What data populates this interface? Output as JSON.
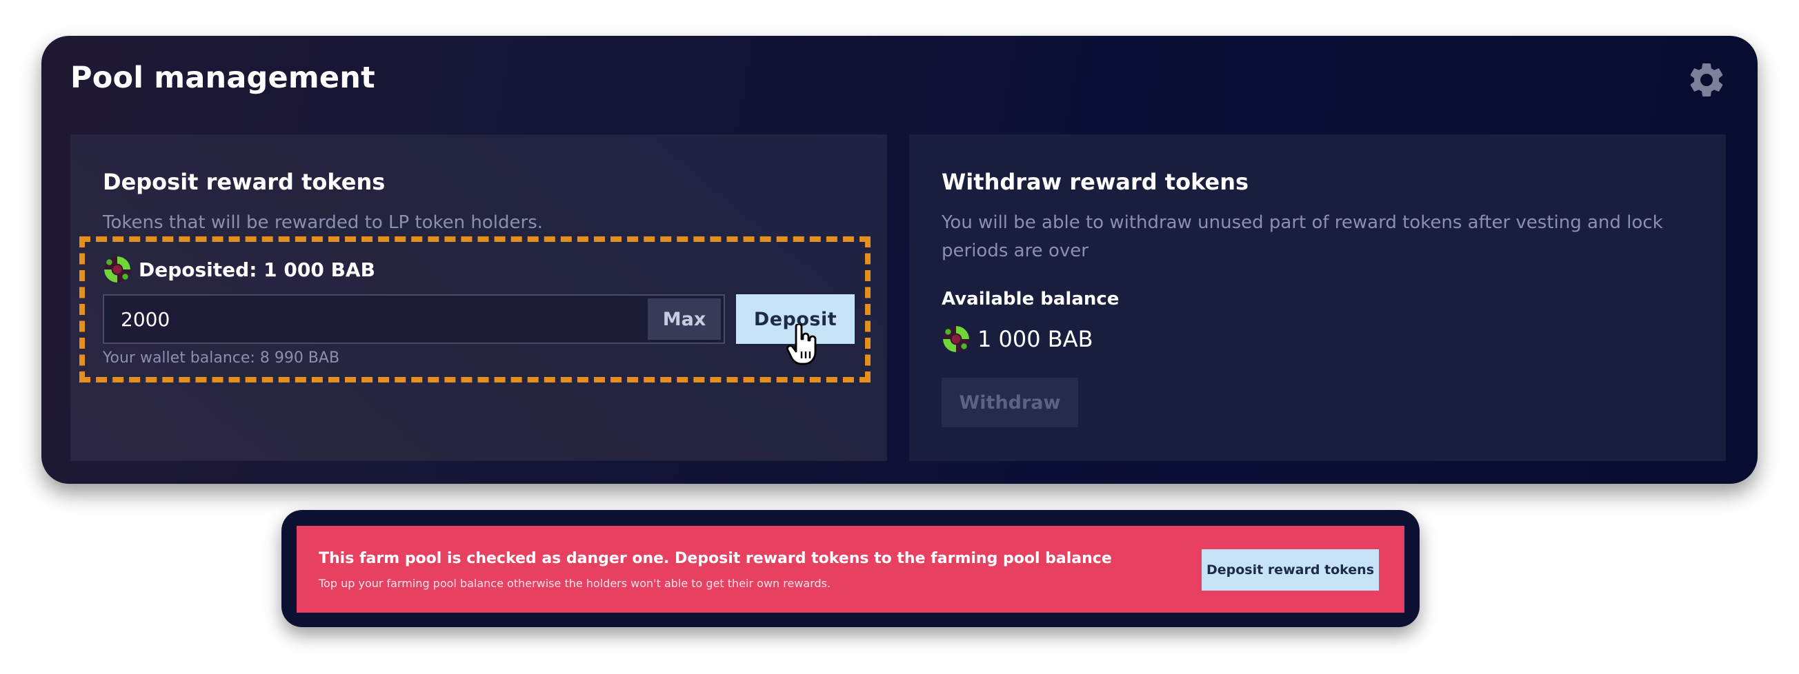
{
  "panel": {
    "title": "Pool management",
    "settings_icon": "gear-icon"
  },
  "deposit_card": {
    "title": "Deposit reward tokens",
    "description": "Tokens that will be rewarded to LP token holders.",
    "deposited_text": "Deposited: 1 000 BAB",
    "token_icon": "bab-token-icon",
    "input": {
      "value": "2000",
      "placeholder": ""
    },
    "max_label": "Max",
    "deposit_label": "Deposit",
    "wallet_balance": "Your wallet balance: 8 990 BAB",
    "highlight_color": "#e3901c"
  },
  "withdraw_card": {
    "title": "Withdraw reward tokens",
    "description": "You will be able to withdraw unused part of reward tokens after vesting and lock periods are over",
    "available_label": "Available balance",
    "available_amount": "1 000 BAB",
    "withdraw_label": "Withdraw"
  },
  "banner": {
    "title": "This farm pool is checked as danger one. Deposit reward tokens to the farming pool balance",
    "subtitle": "Top up your farming pool balance otherwise the holders won't able to get their own rewards.",
    "button_label": "Deposit reward tokens",
    "color": "#e84061"
  },
  "colors": {
    "accent_button": "#c7e3f7",
    "panel_background": "#0c0f35"
  }
}
